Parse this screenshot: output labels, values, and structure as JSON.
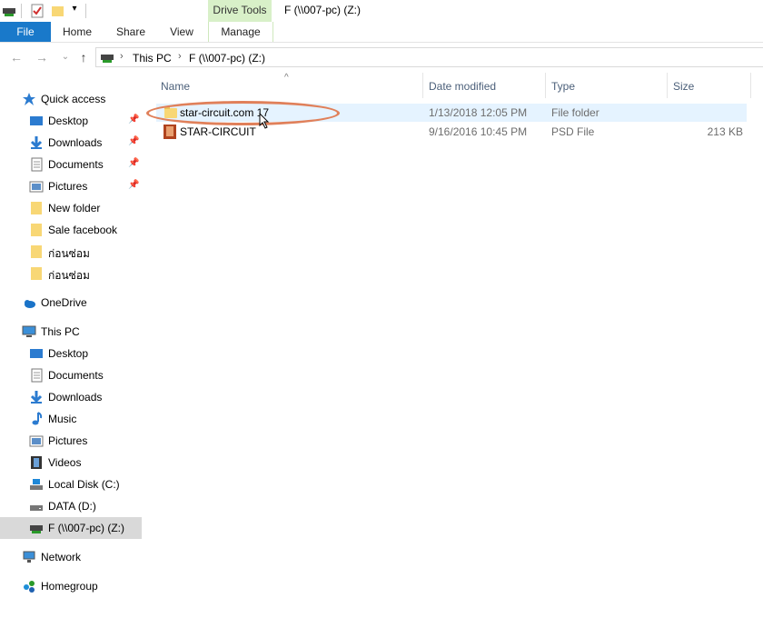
{
  "titlebar": {
    "title": "F (\\\\007-pc) (Z:)",
    "context_tab": "Drive Tools"
  },
  "ribbon": {
    "tabs": [
      "File",
      "Home",
      "Share",
      "View",
      "Manage"
    ]
  },
  "address": {
    "crumbs": [
      "This PC",
      "F (\\\\007-pc) (Z:)"
    ]
  },
  "columns": {
    "name": "Name",
    "date": "Date modified",
    "type": "Type",
    "size": "Size"
  },
  "files": [
    {
      "name": "star-circuit.com 17",
      "date": "1/13/2018 12:05 PM",
      "type": "File folder",
      "size": ""
    },
    {
      "name": "STAR-CIRCUIT",
      "date": "9/16/2016 10:45 PM",
      "type": "PSD File",
      "size": "213 KB"
    }
  ],
  "sidebar": {
    "quick_access": "Quick access",
    "quick_items": [
      "Desktop",
      "Downloads",
      "Documents",
      "Pictures",
      "New folder",
      "Sale facebook",
      "ก่อนซ่อม",
      "ก่อนซ่อม"
    ],
    "onedrive": "OneDrive",
    "this_pc": "This PC",
    "pc_items": [
      "Desktop",
      "Documents",
      "Downloads",
      "Music",
      "Pictures",
      "Videos",
      "Local Disk (C:)",
      "DATA (D:)",
      "F (\\\\007-pc) (Z:)"
    ],
    "network": "Network",
    "homegroup": "Homegroup"
  },
  "colors": {
    "file_tab": "#1979ca",
    "selection": "#e5f3ff",
    "highlight_ellipse": "#e0805a",
    "drive_tools": "#d8f0c8"
  }
}
